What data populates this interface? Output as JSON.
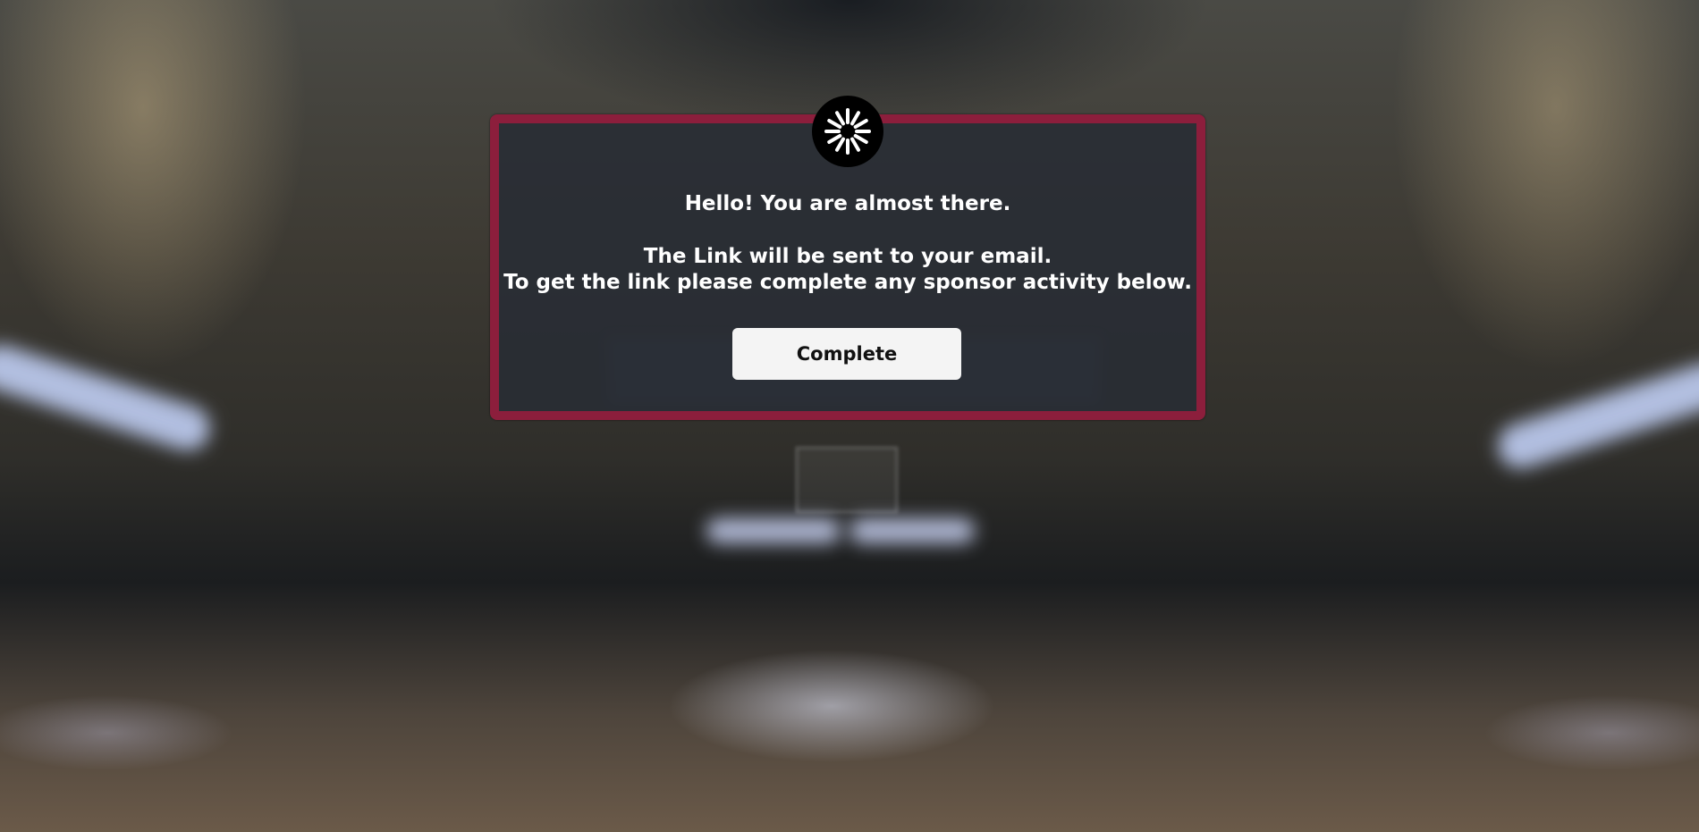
{
  "background": {
    "description_color": "#3d3a33"
  },
  "modal": {
    "border_color": "#8c1e3c",
    "spinner_icon": "loading-spinner-icon",
    "greeting": "Hello! You are almost there.",
    "line_email": "The Link will be sent to your email.",
    "line_instruction": "To get the link please complete any sponsor activity below.",
    "button_label": "Complete"
  }
}
